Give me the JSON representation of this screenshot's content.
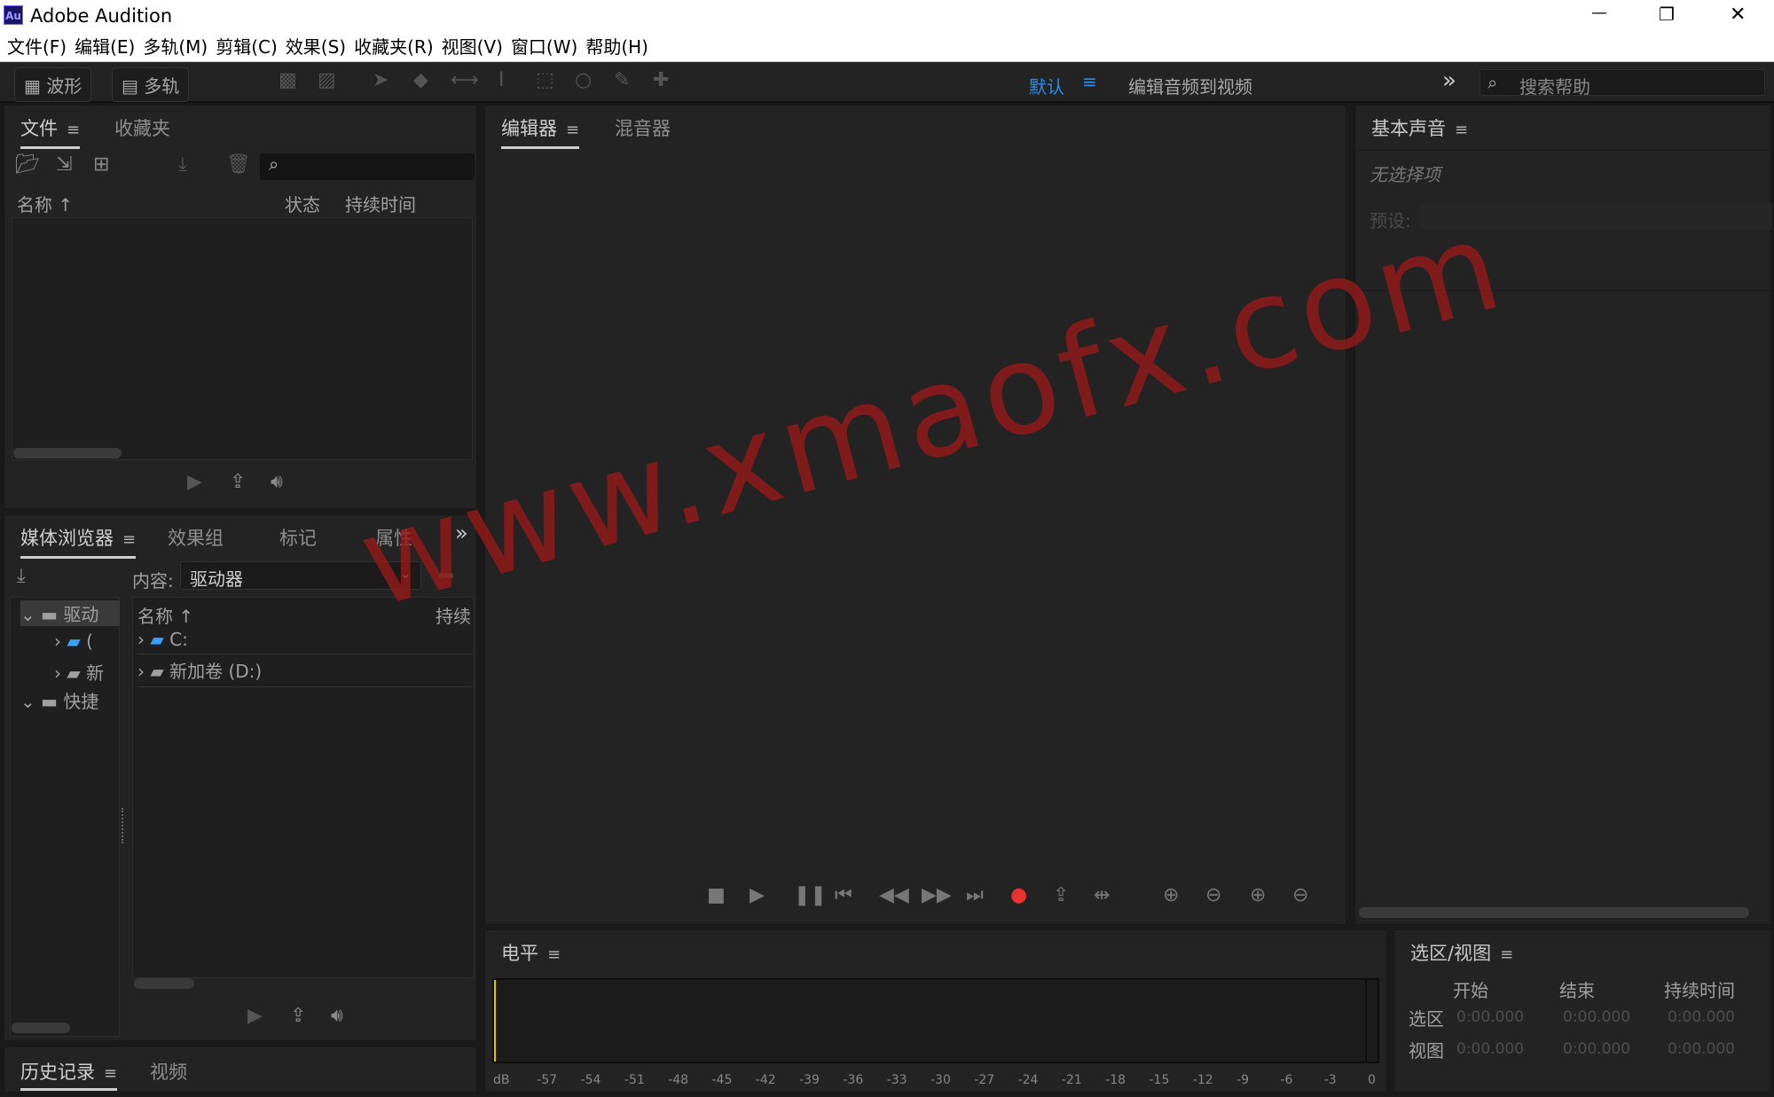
{
  "window": {
    "app_icon": "Au",
    "title": "Adobe Audition",
    "minimize": "—",
    "restore": "❐",
    "close": "✕"
  },
  "menu": [
    "文件(F)",
    "编辑(E)",
    "多轨(M)",
    "剪辑(C)",
    "效果(S)",
    "收藏夹(R)",
    "视图(V)",
    "窗口(W)",
    "帮助(H)"
  ],
  "toolbar": {
    "waveform": "波形",
    "multitrack": "多轨",
    "workspace_default": "默认",
    "workspace_edit_video": "编辑音频到视频",
    "more": "»",
    "search_placeholder": "搜索帮助",
    "accent": "#2d8ceb"
  },
  "files_panel": {
    "tabs": [
      "文件",
      "收藏夹"
    ],
    "columns": [
      "名称 ↑",
      "状态",
      "持续时间"
    ]
  },
  "media_browser": {
    "tabs": [
      "媒体浏览器",
      "效果组",
      "标记",
      "属性"
    ],
    "content_label": "内容:",
    "content_value": "驱动器",
    "tree": [
      "驱动",
      "(",
      "新",
      "快捷"
    ],
    "columns": [
      "名称 ↑",
      "持续"
    ],
    "items": [
      "C:",
      "新加卷 (D:)"
    ]
  },
  "history": {
    "tabs": [
      "历史记录",
      "视频"
    ]
  },
  "editor": {
    "tabs": [
      "编辑器",
      "混音器"
    ],
    "record_color": "#e8322d"
  },
  "essential_sound": {
    "title": "基本声音",
    "no_selection": "无选择项",
    "preset_label": "预设:"
  },
  "levels": {
    "title": "电平",
    "ticks": [
      "dB",
      "-57",
      "-54",
      "-51",
      "-48",
      "-45",
      "-42",
      "-39",
      "-36",
      "-33",
      "-30",
      "-27",
      "-24",
      "-21",
      "-18",
      "-15",
      "-12",
      "-9",
      "-6",
      "-3",
      "0"
    ]
  },
  "selection_view": {
    "title": "选区/视图",
    "columns": [
      "开始",
      "结束",
      "持续时间"
    ],
    "rows": [
      {
        "label": "选区",
        "values": [
          "0:00.000",
          "0:00.000",
          "0:00.000"
        ]
      },
      {
        "label": "视图",
        "values": [
          "0:00.000",
          "0:00.000",
          "0:00.000"
        ]
      }
    ]
  },
  "watermark": "www.xmaofx.com"
}
